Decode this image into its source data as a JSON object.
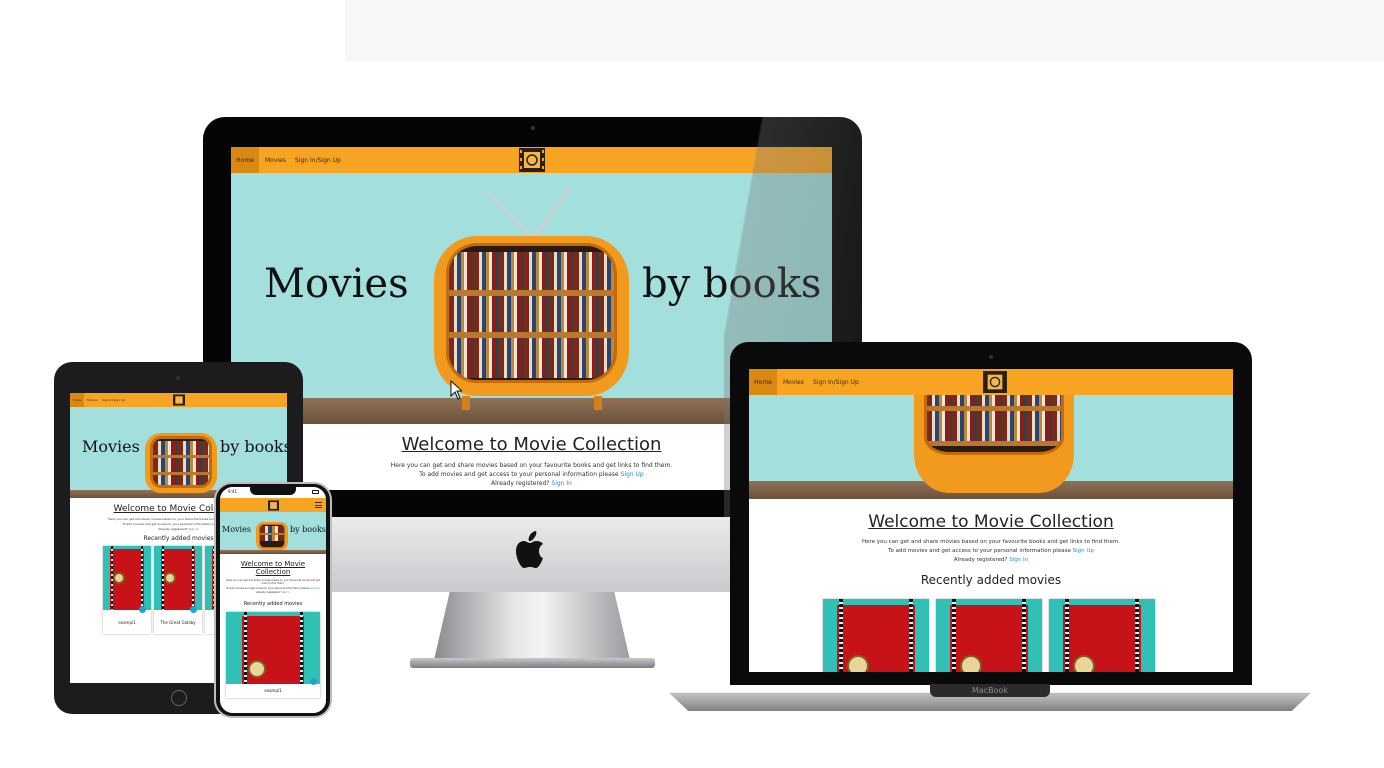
{
  "site": {
    "nav": [
      {
        "label": "Home",
        "active": true
      },
      {
        "label": "Movies",
        "active": false
      },
      {
        "label": "Sign In/Sign Up",
        "active": false
      }
    ],
    "logo_icon": "film-reel-logo-icon",
    "hero_left": "Movies",
    "hero_right": "by books",
    "welcome": "Welcome to Movie Collection",
    "intro_line": "Here you can get and share movies based on your favourite books and get links to find them.",
    "add_line_prefix": "To add movies and get access to your personal information please",
    "signup_link": "Sign Up",
    "registered_prefix": "Already registered?",
    "signin_link": "Sign In",
    "recent_title": "Recently added movies",
    "movies": [
      {
        "title": "exampl1"
      },
      {
        "title": "The Great Gatsby"
      },
      {
        "title": ""
      }
    ],
    "colors": {
      "nav": "#f8a423",
      "nav_active": "#d98912",
      "hero_bg": "#a2dfdd",
      "link": "#1e8fd6"
    }
  },
  "devices": {
    "phone_time": "9:41",
    "laptop_brand": "MacBook"
  }
}
